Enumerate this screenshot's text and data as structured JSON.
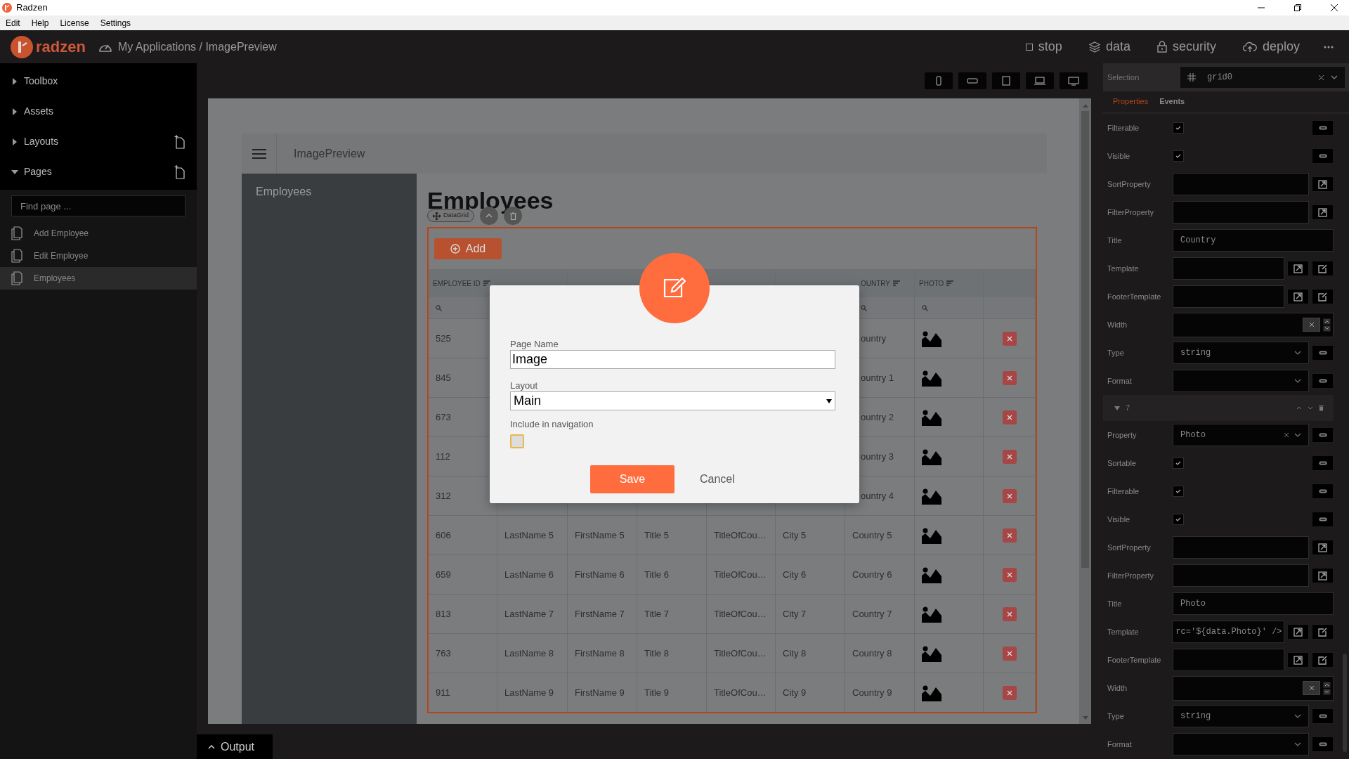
{
  "window": {
    "title": "Radzen"
  },
  "menu": [
    "Edit",
    "Help",
    "License",
    "Settings"
  ],
  "header": {
    "logo": "radzen",
    "breadcrumb": "My Applications / ImagePreview",
    "actions": [
      {
        "kind": "stop",
        "label": "stop"
      },
      {
        "kind": "data",
        "label": "data"
      },
      {
        "kind": "security",
        "label": "security"
      },
      {
        "kind": "deploy",
        "label": "deploy"
      }
    ]
  },
  "sidebar": {
    "sections": [
      {
        "label": "Toolbox",
        "expanded": false,
        "addable": false
      },
      {
        "label": "Assets",
        "expanded": false,
        "addable": false
      },
      {
        "label": "Layouts",
        "expanded": false,
        "addable": true
      },
      {
        "label": "Pages",
        "expanded": true,
        "addable": true
      }
    ],
    "search": {
      "placeholder": "Find page ..."
    },
    "pages": [
      {
        "label": "Add Employee",
        "selected": false
      },
      {
        "label": "Edit Employee",
        "selected": false
      },
      {
        "label": "Employees",
        "selected": true
      }
    ]
  },
  "canvas": {
    "app_title": "ImagePreview",
    "nav": [
      "Employees"
    ],
    "heading": "Employees",
    "component_chip": "DataGrid",
    "add_button": "Add",
    "grid": {
      "columns": [
        "EMPLOYEE ID",
        null,
        null,
        null,
        null,
        null,
        "OUNTRY",
        "PHOTO"
      ],
      "rows": [
        [
          "525",
          null,
          null,
          null,
          null,
          null,
          "ountry"
        ],
        [
          "845",
          null,
          null,
          null,
          null,
          null,
          "ountry 1"
        ],
        [
          "673",
          null,
          null,
          null,
          null,
          null,
          "ountry 2"
        ],
        [
          "112",
          null,
          null,
          null,
          null,
          null,
          "ountry 3"
        ],
        [
          "312",
          null,
          null,
          null,
          null,
          null,
          "ountry 4"
        ],
        [
          "606",
          "LastName 5",
          "FirstName 5",
          "Title 5",
          "TitleOfCou…",
          "City 5",
          "Country 5"
        ],
        [
          "659",
          "LastName 6",
          "FirstName 6",
          "Title 6",
          "TitleOfCou…",
          "City 6",
          "Country 6"
        ],
        [
          "813",
          "LastName 7",
          "FirstName 7",
          "Title 7",
          "TitleOfCou…",
          "City 7",
          "Country 7"
        ],
        [
          "763",
          "LastName 8",
          "FirstName 8",
          "Title 8",
          "TitleOfCou…",
          "City 8",
          "Country 8"
        ],
        [
          "911",
          "LastName 9",
          "FirstName 9",
          "Title 9",
          "TitleOfCou…",
          "City 9",
          "Country 9"
        ]
      ]
    }
  },
  "dialog": {
    "fields": [
      {
        "kind": "text",
        "label": "Page Name",
        "value": "Image"
      },
      {
        "kind": "select",
        "label": "Layout",
        "value": "Main"
      },
      {
        "kind": "checkbox",
        "label": "Include in navigation",
        "checked": false
      }
    ],
    "save": "Save",
    "cancel": "Cancel"
  },
  "properties": {
    "selection": {
      "label": "Selection",
      "value": "grid0"
    },
    "tabs": [
      {
        "label": "Properties",
        "selected": true
      },
      {
        "label": "Events",
        "selected": false
      }
    ],
    "groups": [
      {
        "rows": [
          {
            "kind": "checkbox",
            "label": "Filterable",
            "checked": true
          },
          {
            "kind": "checkbox",
            "label": "Visible",
            "checked": true
          },
          {
            "kind": "expression",
            "label": "SortProperty"
          },
          {
            "kind": "expression",
            "label": "FilterProperty"
          },
          {
            "kind": "text",
            "label": "Title",
            "value": "Country"
          },
          {
            "kind": "template",
            "label": "Template"
          },
          {
            "kind": "template",
            "label": "FooterTemplate"
          },
          {
            "kind": "number",
            "label": "Width"
          },
          {
            "kind": "select",
            "label": "Type",
            "value": "string"
          },
          {
            "kind": "select",
            "label": "Format"
          }
        ]
      },
      {
        "title": "7",
        "expanded": true,
        "rows": [
          {
            "kind": "lookup",
            "label": "Property",
            "value": "Photo"
          },
          {
            "kind": "checkbox",
            "label": "Sortable",
            "checked": true
          },
          {
            "kind": "checkbox",
            "label": "Filterable",
            "checked": true
          },
          {
            "kind": "checkbox",
            "label": "Visible",
            "checked": true
          },
          {
            "kind": "expression",
            "label": "SortProperty"
          },
          {
            "kind": "expression",
            "label": "FilterProperty"
          },
          {
            "kind": "text",
            "label": "Title",
            "value": "Photo"
          },
          {
            "kind": "template",
            "label": "Template",
            "value": "rc='${data.Photo}' />"
          },
          {
            "kind": "template",
            "label": "FooterTemplate"
          },
          {
            "kind": "number",
            "label": "Width"
          },
          {
            "kind": "select",
            "label": "Type",
            "value": "string"
          },
          {
            "kind": "select",
            "label": "Format"
          }
        ]
      }
    ]
  },
  "output": {
    "label": "Output"
  }
}
